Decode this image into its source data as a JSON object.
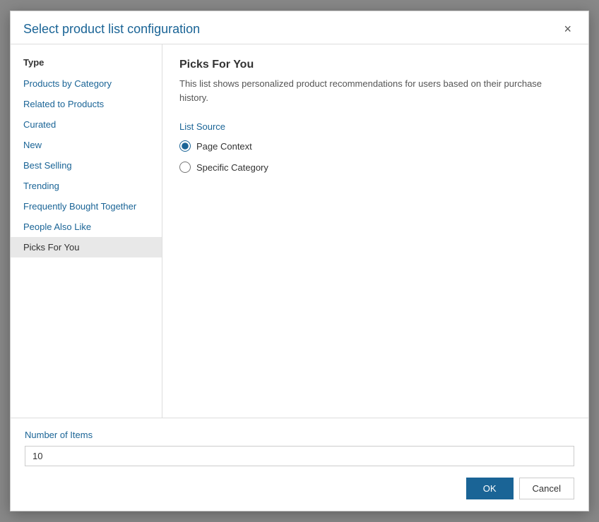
{
  "dialog": {
    "title": "Select product list configuration",
    "close_label": "×"
  },
  "sidebar": {
    "type_label": "Type",
    "items": [
      {
        "id": "products-by-category",
        "label": "Products by Category",
        "active": false
      },
      {
        "id": "related-to-products",
        "label": "Related to Products",
        "active": false
      },
      {
        "id": "curated",
        "label": "Curated",
        "active": false
      },
      {
        "id": "new",
        "label": "New",
        "active": false
      },
      {
        "id": "best-selling",
        "label": "Best Selling",
        "active": false
      },
      {
        "id": "trending",
        "label": "Trending",
        "active": false
      },
      {
        "id": "frequently-bought-together",
        "label": "Frequently Bought Together",
        "active": false
      },
      {
        "id": "people-also-like",
        "label": "People Also Like",
        "active": false
      },
      {
        "id": "picks-for-you",
        "label": "Picks For You",
        "active": true
      }
    ]
  },
  "main": {
    "title": "Picks For You",
    "description": "This list shows personalized product recommendations for users based on their purchase history.",
    "list_source_label": "List Source",
    "radio_options": [
      {
        "id": "page-context",
        "label": "Page Context",
        "checked": true
      },
      {
        "id": "specific-category",
        "label": "Specific Category",
        "checked": false
      }
    ]
  },
  "footer": {
    "number_of_items_label": "Number of Items",
    "number_of_items_value": "10",
    "ok_label": "OK",
    "cancel_label": "Cancel"
  }
}
